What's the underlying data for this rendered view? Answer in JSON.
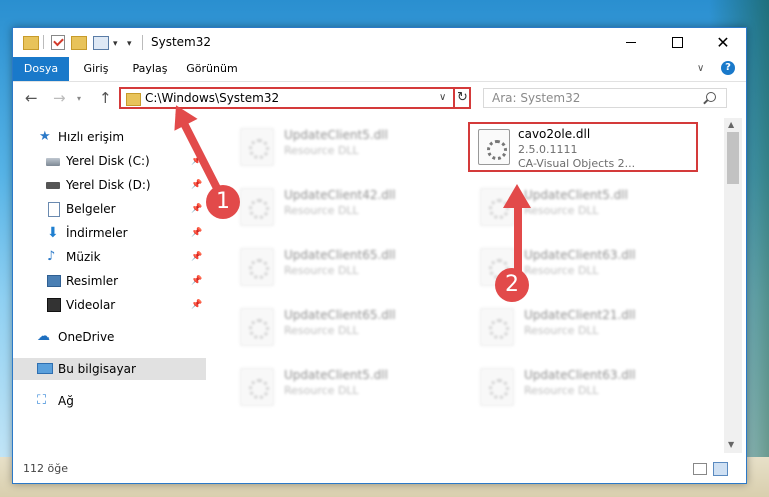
{
  "window": {
    "title": "System32",
    "controls": {
      "close": "✕"
    }
  },
  "ribbon": {
    "tabs": [
      "Dosya",
      "Giriş",
      "Paylaş",
      "Görünüm"
    ]
  },
  "navigation": {
    "address": "C:\\Windows\\System32",
    "search_placeholder": "Ara: System32"
  },
  "sidebar": {
    "items": [
      {
        "label": "Hızlı erişim",
        "icon": "star-icon"
      },
      {
        "label": "Yerel Disk (C:)",
        "icon": "drive-icon",
        "pinned": true
      },
      {
        "label": "Yerel Disk (D:)",
        "icon": "drive-icon",
        "pinned": true
      },
      {
        "label": "Belgeler",
        "icon": "documents-icon",
        "pinned": true
      },
      {
        "label": "İndirmeler",
        "icon": "downloads-icon",
        "pinned": true
      },
      {
        "label": "Müzik",
        "icon": "music-icon",
        "pinned": true
      },
      {
        "label": "Resimler",
        "icon": "pictures-icon",
        "pinned": true
      },
      {
        "label": "Videolar",
        "icon": "videos-icon",
        "pinned": true
      },
      {
        "label": "OneDrive",
        "icon": "cloud-icon"
      },
      {
        "label": "Bu bilgisayar",
        "icon": "computer-icon",
        "selected": true
      },
      {
        "label": "Ağ",
        "icon": "network-icon"
      }
    ]
  },
  "files": {
    "highlighted": {
      "name": "cavo2ole.dll",
      "version": "2.5.0.1111",
      "description": "CA-Visual Objects 2..."
    },
    "items": [
      {
        "name": "UpdateClient5.dll",
        "type": "Resource DLL"
      },
      {
        "name": "UpdateClient42.dll",
        "type": "Resource DLL"
      },
      {
        "name": "UpdateClient5.dll",
        "type": "Resource DLL"
      },
      {
        "name": "UpdateClient65.dll",
        "type": "Resource DLL"
      },
      {
        "name": "UpdateClient63.dll",
        "type": "Resource DLL"
      },
      {
        "name": "UpdateClient65.dll",
        "type": "Resource DLL"
      },
      {
        "name": "UpdateClient21.dll",
        "type": "Resource DLL"
      },
      {
        "name": "UpdateClient5.dll",
        "type": "Resource DLL"
      },
      {
        "name": "UpdateClient63.dll",
        "type": "Resource DLL"
      }
    ]
  },
  "status": {
    "item_count": "112 öğe"
  },
  "callouts": {
    "one": "1",
    "two": "2"
  },
  "colors": {
    "accent": "#1979ca",
    "callout": "#e24a4a",
    "highlight_border": "#d43a3a"
  }
}
